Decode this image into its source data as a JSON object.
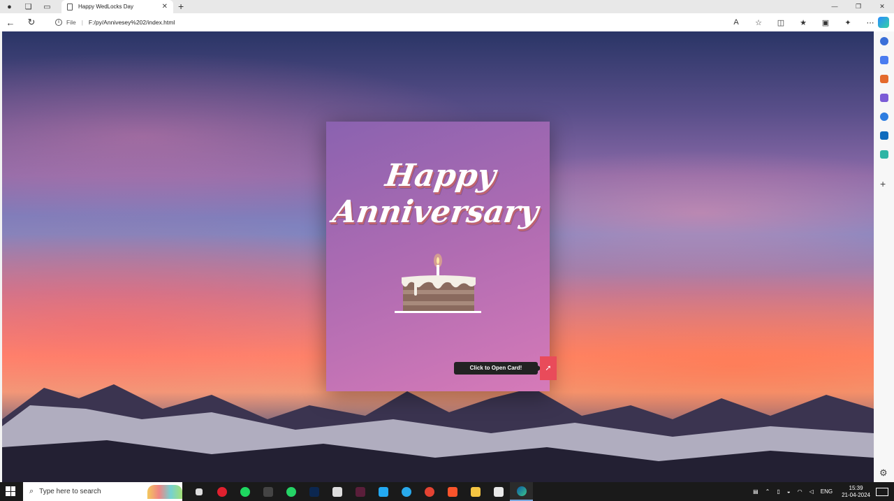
{
  "browser": {
    "tab_title": "Happy WedLocks Day",
    "tab_close": "✕",
    "new_tab": "+",
    "url_scheme_label": "File",
    "url_separator": "|",
    "url": "F:/py/Annivesey%202/index.html",
    "window_controls": [
      "—",
      "❐",
      "✕"
    ]
  },
  "card": {
    "title_line1": "Happy",
    "title_line2": "Anniversary",
    "open_label": "Click to Open Card!",
    "open_button_icon": "➚"
  },
  "taskbar": {
    "search_placeholder": "Type here to search",
    "tray_language": "ENG",
    "clock_time": "15:39",
    "clock_date": "21-04-2024",
    "apps": [
      "task-view",
      "opera",
      "spotify",
      "cmd",
      "whatsapp",
      "photoshop",
      "roblox",
      "arduino",
      "vscode",
      "telegram",
      "todoist",
      "brave",
      "file-explorer",
      "store",
      "edge"
    ]
  },
  "colors": {
    "card_gradient_start": "#8a62b0",
    "card_gradient_end": "#d67ab8",
    "open_button": "#e94b5a",
    "title_shadow": "#c0646e"
  }
}
